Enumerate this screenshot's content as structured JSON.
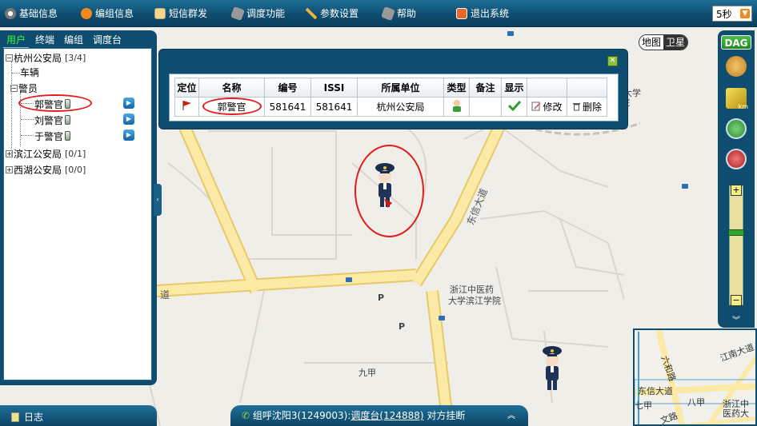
{
  "toolbar": {
    "items": [
      {
        "label": "基础信息",
        "icon": "gear-icon"
      },
      {
        "label": "编组信息",
        "icon": "rss-icon"
      },
      {
        "label": "短信群发",
        "icon": "mail-icon"
      },
      {
        "label": "调度功能",
        "icon": "dispatch-icon"
      },
      {
        "label": "参数设置",
        "icon": "wrench-icon"
      },
      {
        "label": "帮助",
        "icon": "help-icon"
      },
      {
        "label": "退出系统",
        "icon": "exit-icon"
      }
    ],
    "refresh_interval": "5秒"
  },
  "left_panel": {
    "tabs": [
      "用户",
      "终端",
      "编组",
      "调度台"
    ],
    "active_tab": "用户",
    "tree": {
      "root1": {
        "label": "杭州公安局",
        "count": "[3/4]"
      },
      "vehicles": "车辆",
      "police": "警员",
      "officers": [
        "郭警官",
        "刘警官",
        "于警官"
      ],
      "root2": {
        "label": "滨江公安局",
        "count": "[0/1]"
      },
      "root3": {
        "label": "西湖公安局",
        "count": "[0/0]"
      }
    }
  },
  "popup": {
    "headers": [
      "定位",
      "名称",
      "编号",
      "ISSI",
      "所属单位",
      "类型",
      "备注",
      "显示",
      "",
      ""
    ],
    "row": {
      "name": "郭警官",
      "number": "581641",
      "issi": "581641",
      "unit": "杭州公安局",
      "remark": "",
      "edit_label": "修改",
      "delete_label": "删除"
    }
  },
  "map": {
    "type_buttons": [
      "地图",
      "卫星"
    ],
    "active_type": "地图",
    "labels": {
      "road_dongxin": "东信大道",
      "road_left": "道",
      "poi_1": "浙江中医药",
      "poi_1b": "大学滨江学院",
      "poi_2": "九甲",
      "poi_top_right": "工大学",
      "poi_top_right_b": "院",
      "p1": "P",
      "p2": "P"
    }
  },
  "right_bar": {
    "logo": "DAG",
    "ruler_label": "km"
  },
  "overview": {
    "labels": [
      "江南大道",
      "六和路",
      "东信大道",
      "八甲",
      "浙江中",
      "医药大",
      "文路",
      "七甲"
    ]
  },
  "bottom": {
    "log_label": "日志",
    "status_prefix": "组呼沈阳3(1249003):",
    "status_link": "调度台(124888)",
    "status_suffix": "对方挂断"
  }
}
